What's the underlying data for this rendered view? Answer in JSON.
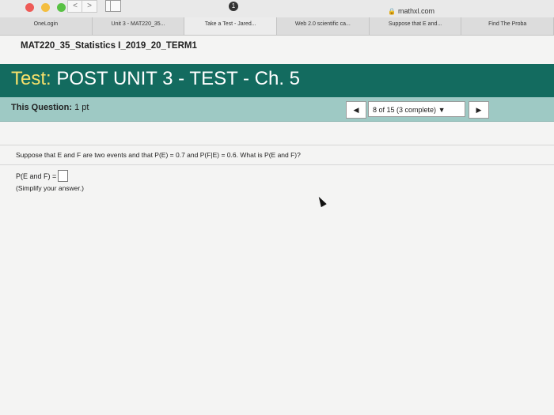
{
  "browser": {
    "address": "mathxl.com",
    "tabs": [
      "OneLogin",
      "Unit 3 - MAT220_35...",
      "Take a Test - Jared...",
      "Web 2.0 scientific ca...",
      "Suppose that E and...",
      "Find The Proba"
    ],
    "back_icon": "<",
    "forward_icon": ">",
    "extension_badge": "1"
  },
  "course": {
    "title": "MAT220_35_Statistics I_2019_20_TERM1"
  },
  "test": {
    "prefix": "Test:",
    "name": "POST UNIT 3 - TEST - Ch. 5"
  },
  "question_bar": {
    "label": "This Question:",
    "points": "1 pt",
    "progress": "8 of 15 (3 complete)",
    "prev_icon": "◀",
    "next_icon": "▶",
    "dropdown_icon": "▼"
  },
  "question": {
    "text": "Suppose that E and F are two events and that P(E) = 0.7 and P(F|E) = 0.6. What is P(E and F)?",
    "answer_label": "P(E and F) =",
    "hint": "(Simplify your answer.)",
    "answer_value": ""
  },
  "colors": {
    "header_bg": "#136b5f",
    "qbar_bg": "#9ec9c4",
    "prefix": "#f5e06a"
  }
}
